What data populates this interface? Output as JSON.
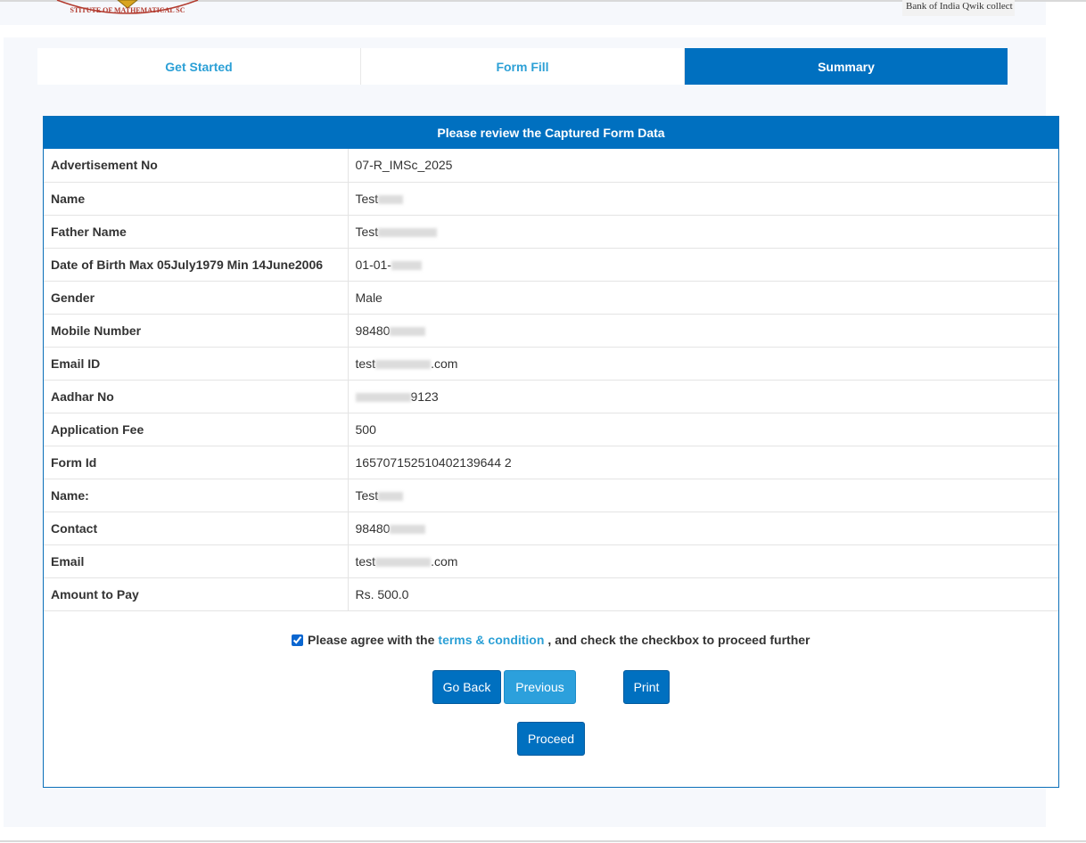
{
  "header": {
    "logo_left_text": "STITUTE OF MATHEMATICAL SC",
    "logo_right_text": "Bank of India Qwik collect"
  },
  "wizard": {
    "steps": [
      {
        "label": "Get Started"
      },
      {
        "label": "Form Fill"
      },
      {
        "label": "Summary"
      }
    ]
  },
  "review": {
    "title": "Please review the Captured Form Data",
    "rows": [
      {
        "label": "Advertisement No",
        "value": "07-R_IMSc_2025"
      },
      {
        "label": "Name",
        "value": "Test"
      },
      {
        "label": "Father Name",
        "value": "Test"
      },
      {
        "label": "Date of Birth Max 05July1979 Min 14June2006",
        "value": "01-01-"
      },
      {
        "label": "Gender",
        "value": "Male"
      },
      {
        "label": "Mobile Number",
        "value": "98480"
      },
      {
        "label": "Email ID",
        "value": "test",
        "suffix": ".com"
      },
      {
        "label": "Aadhar No",
        "value": "9123"
      },
      {
        "label": "Application Fee",
        "value": "500"
      },
      {
        "label": "Form Id",
        "value": "165707152510402139644 2"
      },
      {
        "label": "Name:",
        "value": "Test"
      },
      {
        "label": "Contact",
        "value": "98480"
      },
      {
        "label": "Email",
        "value": "test",
        "suffix": ".com"
      },
      {
        "label": "Amount to Pay",
        "value": "Rs. 500.0"
      }
    ]
  },
  "agreement": {
    "checked": true,
    "prefix": "Please agree with the",
    "link": "terms & condition",
    "suffix": ", and check the checkbox to proceed further"
  },
  "buttons": {
    "go_back": "Go Back",
    "previous": "Previous",
    "print": "Print",
    "proceed": "Proceed"
  },
  "colors": {
    "primary": "#0070c0",
    "link": "#2ca0d6",
    "panel": "#f6f8fc"
  }
}
